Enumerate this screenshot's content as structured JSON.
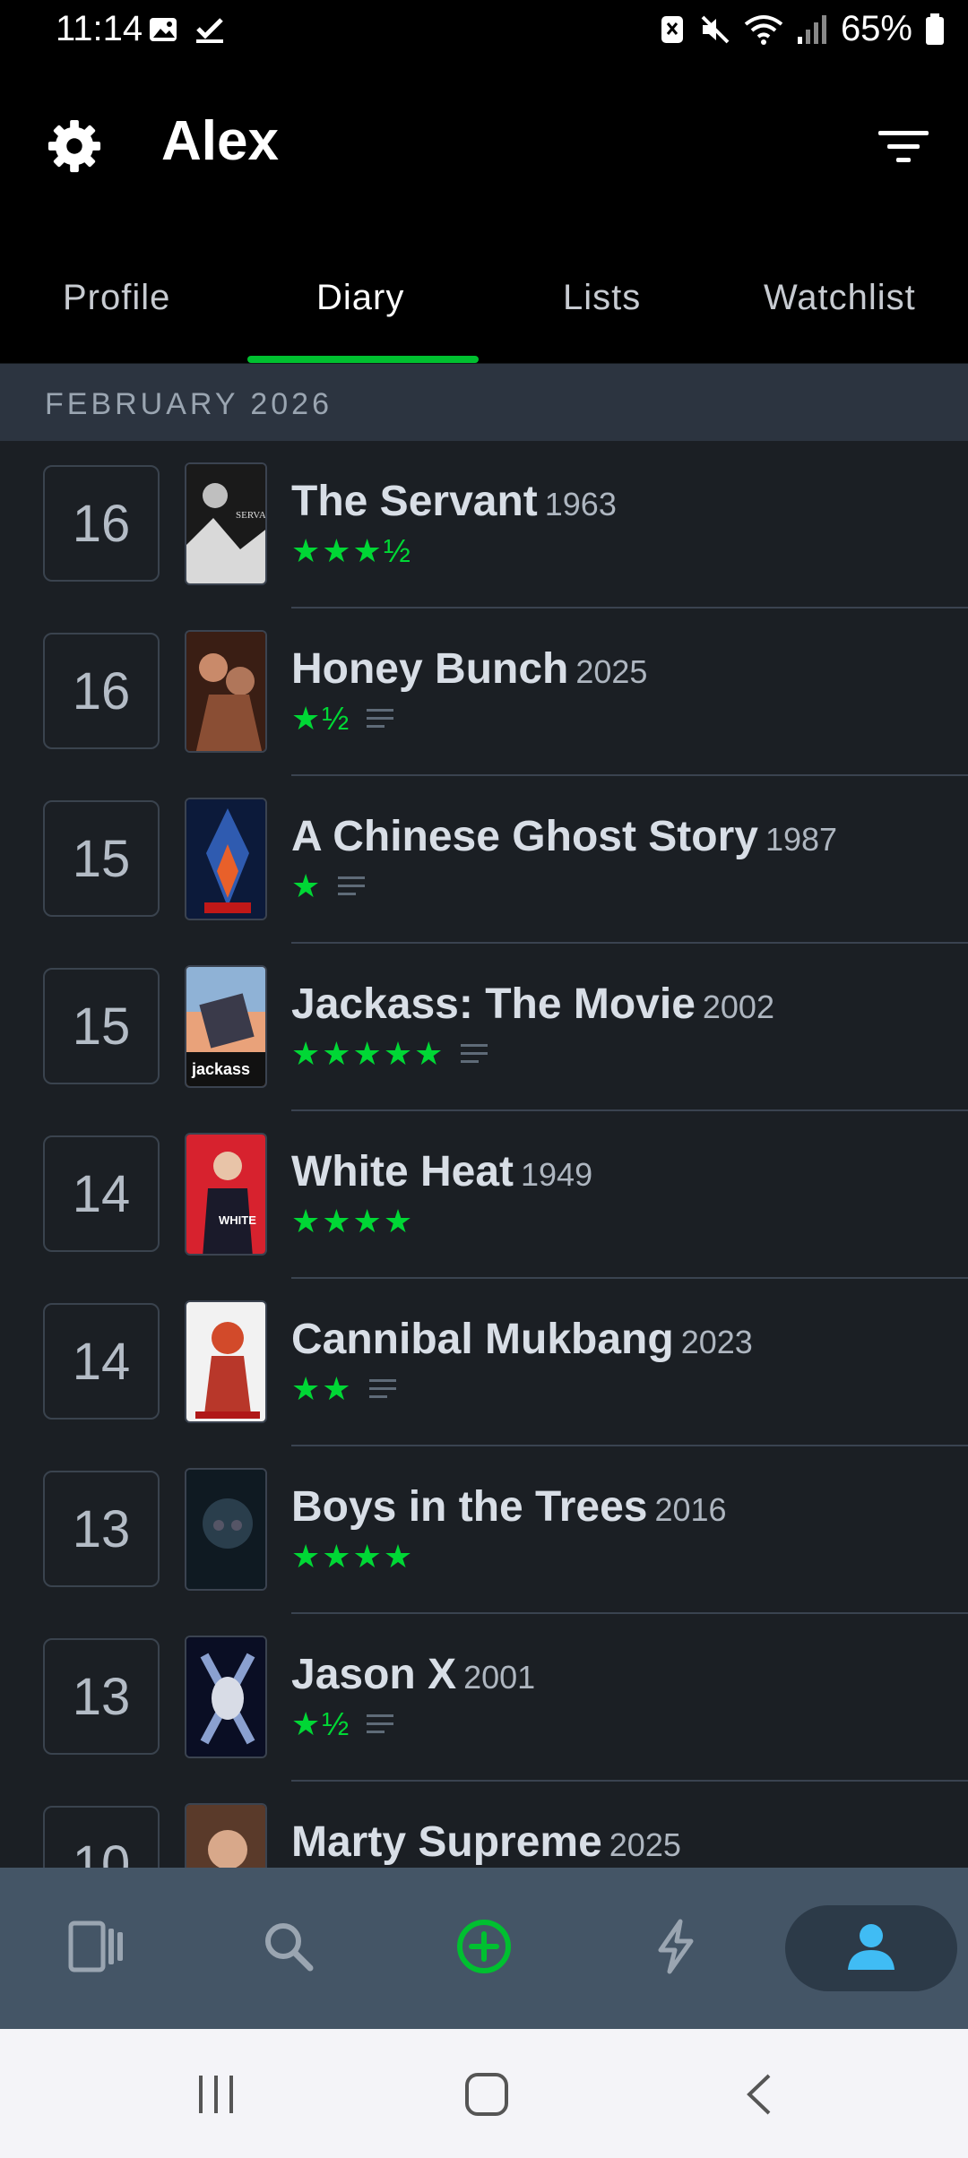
{
  "status_bar": {
    "time": "11:14",
    "battery": "65%"
  },
  "header": {
    "title": "Alex"
  },
  "tabs": [
    {
      "label": "Profile",
      "active": false
    },
    {
      "label": "Diary",
      "active": true
    },
    {
      "label": "Lists",
      "active": false
    },
    {
      "label": "Watchlist",
      "active": false
    }
  ],
  "month_header": "FEBRUARY 2026",
  "entries": [
    {
      "day": "16",
      "title": "The Servant",
      "year": "1963",
      "stars": "★★★½",
      "has_review": false
    },
    {
      "day": "16",
      "title": "Honey Bunch",
      "year": "2025",
      "stars": "★½",
      "has_review": true
    },
    {
      "day": "15",
      "title": "A Chinese Ghost Story",
      "year": "1987",
      "stars": "★",
      "has_review": true
    },
    {
      "day": "15",
      "title": "Jackass: The Movie",
      "year": "2002",
      "stars": "★★★★★",
      "has_review": true
    },
    {
      "day": "14",
      "title": "White Heat",
      "year": "1949",
      "stars": "★★★★",
      "has_review": false
    },
    {
      "day": "14",
      "title": "Cannibal Mukbang",
      "year": "2023",
      "stars": "★★",
      "has_review": true
    },
    {
      "day": "13",
      "title": "Boys in the Trees",
      "year": "2016",
      "stars": "★★★★",
      "has_review": false
    },
    {
      "day": "13",
      "title": "Jason X",
      "year": "2001",
      "stars": "★½",
      "has_review": true
    },
    {
      "day": "10",
      "title": "Marty Supreme",
      "year": "2025",
      "stars": "",
      "has_review": false
    }
  ],
  "bottom_nav": [
    {
      "icon": "films-icon",
      "active": false
    },
    {
      "icon": "search-icon",
      "active": false
    },
    {
      "icon": "add-log-icon",
      "active": false
    },
    {
      "icon": "activity-icon",
      "active": false
    },
    {
      "icon": "profile-icon",
      "active": true
    }
  ],
  "colors": {
    "accent_green": "#00c030",
    "star_green": "#00d735",
    "background": "#14181c",
    "active_blue": "#40bcf4"
  }
}
